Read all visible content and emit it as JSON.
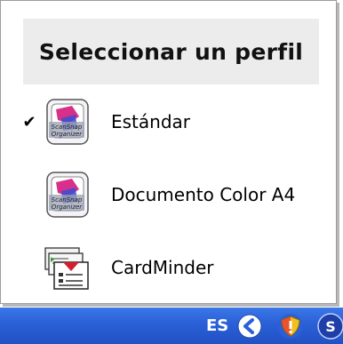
{
  "menu": {
    "title": "Seleccionar un perfil",
    "items": [
      {
        "label": "Estándar",
        "checked": true,
        "icon": "scansnap-organizer-icon"
      },
      {
        "label": "Documento Color A4",
        "checked": false,
        "icon": "scansnap-organizer-icon"
      },
      {
        "label": "CardMinder",
        "checked": false,
        "icon": "cardminder-icon"
      }
    ],
    "check_mark": "✔"
  },
  "taskbar": {
    "language": "ES",
    "tray_icons": [
      "back-arrow-icon",
      "security-shield-icon",
      "scansnap-manager-icon"
    ],
    "color": "#2a5fd6"
  }
}
